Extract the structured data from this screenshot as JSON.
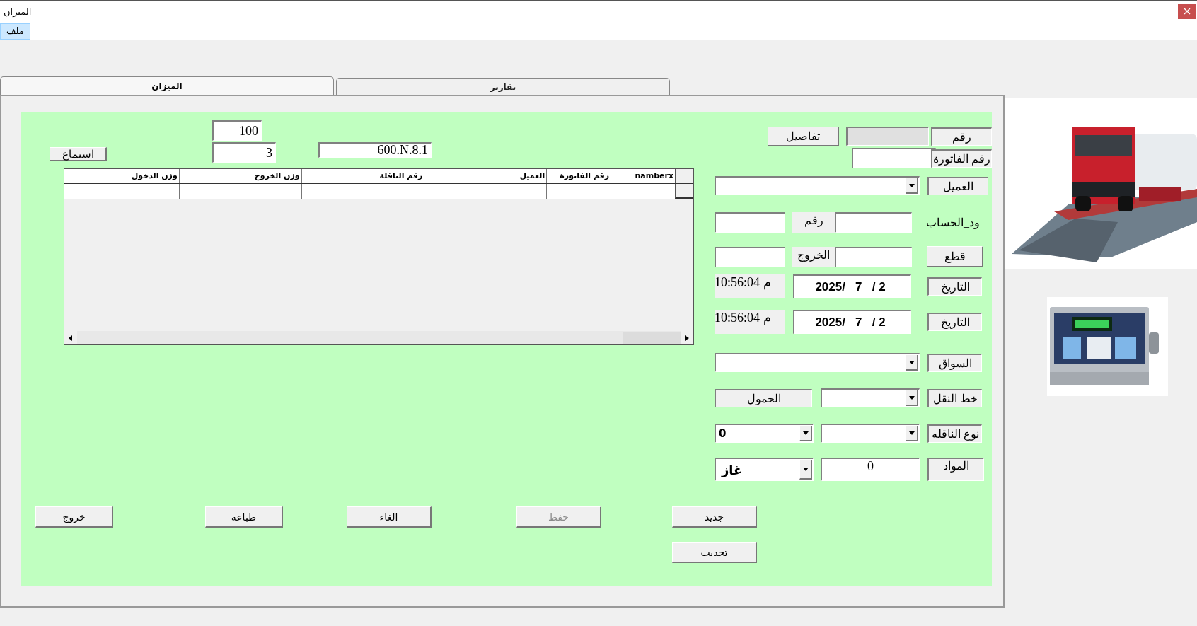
{
  "window": {
    "title": "الميزان"
  },
  "menu": [
    {
      "label": "ملف",
      "selected": true
    }
  ],
  "tabs": [
    {
      "label": "تقارير",
      "selected": false
    },
    {
      "label": "الميزان",
      "selected": true
    }
  ],
  "top": {
    "listen_button": "استماع",
    "counter_1": "100",
    "counter_2": "3",
    "code": "600.N.8.1"
  },
  "table": {
    "columns": [
      "namberx",
      "رقم الفاتورة",
      "العميل",
      "رقم الناقلة",
      "وزن الخروج",
      "وزن الدخول"
    ]
  },
  "form": {
    "number_label": "رقم",
    "details_button": "تفاصيل",
    "invoice_label": "رقم الفاتورة",
    "customer_label": "العميل",
    "account": {
      "label": "ود_الحساب",
      "number_label": "رقم"
    },
    "cut": {
      "button": "قطع",
      "exit_label": "الخروج"
    },
    "dates": [
      {
        "label": "التاريخ",
        "date": "2025/   7   / 2",
        "time": "10:56:04 م"
      },
      {
        "label": "التاريخ",
        "date": "2025/   7   / 2",
        "time": "10:56:04 م"
      }
    ],
    "driver_label": "السواق",
    "transport": {
      "label": "خط النقل",
      "load_label": "الحمول"
    },
    "vehicle_type": {
      "label": "نوع الناقله",
      "count": "0"
    },
    "materials": {
      "label": "المواد",
      "value": "0",
      "type": "غاز"
    }
  },
  "buttons": [
    {
      "label": "جديد",
      "disabled": false
    },
    {
      "label": "حفظ",
      "disabled": true
    },
    {
      "label": "الغاء",
      "disabled": false
    },
    {
      "label": "طباعة",
      "disabled": false
    },
    {
      "label": "خروج",
      "disabled": false
    }
  ],
  "update_button": {
    "label": "تحديت",
    "disabled": false
  }
}
